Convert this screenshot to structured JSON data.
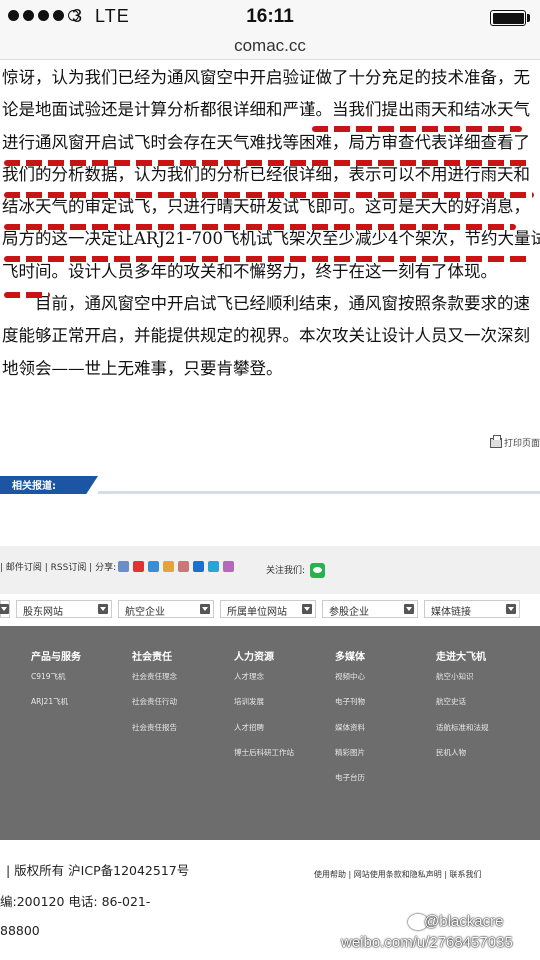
{
  "status_bar": {
    "carrier": "3",
    "network": "LTE",
    "time": "16:11",
    "signal_bars": 4,
    "signal_total": 5
  },
  "browser": {
    "url": "comac.cc"
  },
  "article": {
    "lines": [
      "惊讶，认为我们已经为通风窗空中开启验证做了十分充足的技术准备，无",
      "论是地面试验还是计算分析都很详细和严谨。当我们提出雨天和结冰天气",
      "进行通风窗开启试飞时会存在天气难找等困难，局方审查代表详细查看了",
      "我们的分析数据，认为我们的分析已经很详细，表示可以不用进行雨天和",
      "结冰天气的审定试飞，只进行晴天研发试飞即可。这可是天大的好消息，",
      "局方的这一决定让ARJ21-700飞机试飞架次至少减少4个架次，节约大量试",
      "飞时间。设计人员多年的攻关和不懈努力，终于在这一刻有了体现。",
      "目前，通风窗空中开启试飞已经顺利结束，通风窗按照条款要求的速",
      "度能够正常开启，并能提供规定的视界。本次攻关让设计人员又一次深刻",
      "地领会——世上无难事，只要肯攀登。"
    ],
    "print_label": "打印页面"
  },
  "related": {
    "label": "相关报道:"
  },
  "footer": {
    "link_row": "| 邮件订阅 | RSS订阅 | 分享:",
    "follow_label": "关注我们:",
    "selects": [
      "股东网站",
      "航空企业",
      "所属单位网站",
      "参股企业",
      "媒体链接"
    ],
    "columns": [
      {
        "title": "产品与服务",
        "items": [
          "C919飞机",
          "ARJ21飞机"
        ]
      },
      {
        "title": "社会责任",
        "items": [
          "社会责任理念",
          "社会责任行动",
          "社会责任报告"
        ]
      },
      {
        "title": "人力资源",
        "items": [
          "人才理念",
          "培训发展",
          "人才招聘",
          "博士后科研工作站"
        ]
      },
      {
        "title": "多媒体",
        "items": [
          "视频中心",
          "电子刊物",
          "媒体资料",
          "精彩图片",
          "电子台历"
        ]
      },
      {
        "title": "走进大飞机",
        "items": [
          "航空小知识",
          "航空史话",
          "适航标准和法规",
          "民机人物"
        ]
      }
    ],
    "copyright": "| 版权所有 沪ICP备12042517号",
    "postcode": "编:200120 电话:  86-021-",
    "phone_tail": "88800",
    "bottom_links": "使用帮助 | 网站使用条款和隐私声明 | 联系我们"
  },
  "watermark": {
    "handle": "@blackacre",
    "url": "weibo.com/u/2768457035"
  }
}
